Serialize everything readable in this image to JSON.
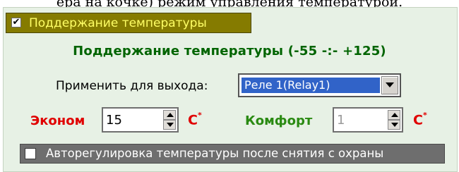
{
  "clipped_text": "ера на кочке) режим управления температурой.",
  "header": {
    "checked": true,
    "check_glyph": "✔",
    "label": "Поддержание температуры"
  },
  "group": {
    "title": "Поддержание температуры (-55 -:- +125)"
  },
  "output": {
    "label": "Применить для выхода:",
    "selected": "Реле 1(Relay1)"
  },
  "econom": {
    "label": "Эконом",
    "value": "15",
    "unit": "С",
    "unit_mark": "*"
  },
  "comfort": {
    "label": "Комфорт",
    "value": "1",
    "unit": "С",
    "unit_mark": "*",
    "disabled": true
  },
  "auto_adjust": {
    "checked": false,
    "label": "Авторегулировка температуры после снятия с охраны"
  },
  "colors": {
    "panel": "#e7f1e5",
    "header_bg": "#857b00",
    "header_text": "#ffff66",
    "title_green": "#006400",
    "label_red": "#e00000",
    "label_green": "#2a8a12",
    "select_highlight": "#3163c8",
    "footer_bg": "#6e6e6e"
  }
}
